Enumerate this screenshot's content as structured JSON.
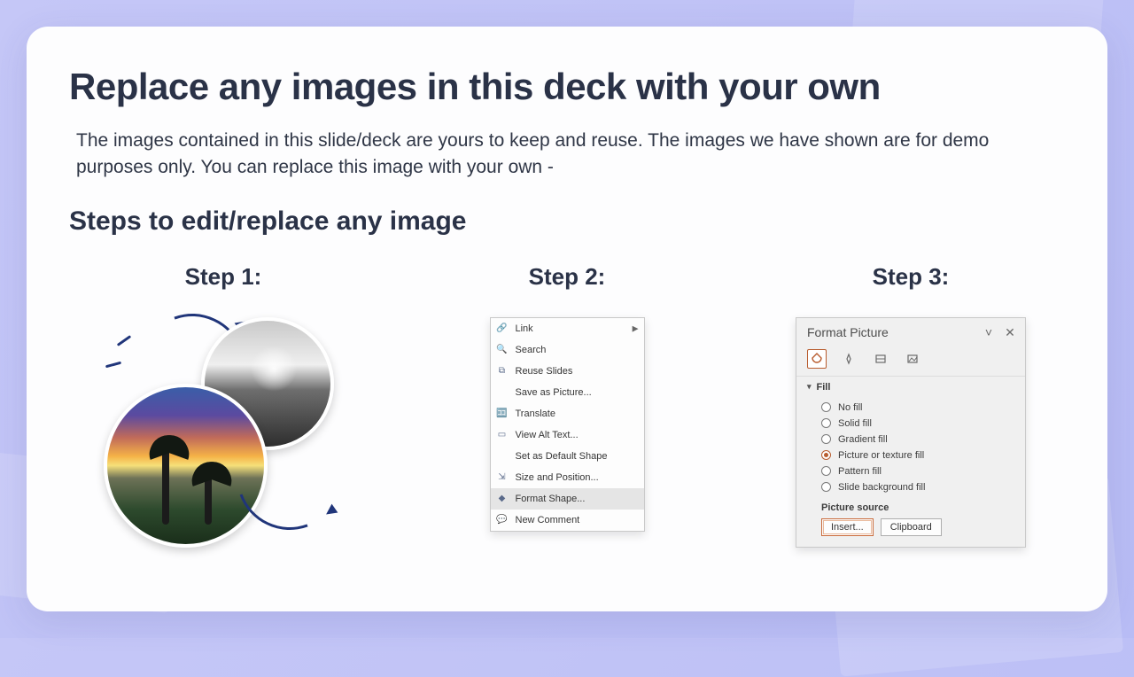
{
  "title": "Replace any images in this deck with your own",
  "description": "The images contained in this slide/deck are yours to keep and reuse. The images we have shown are for demo purposes only. You can replace this image with your own -",
  "subtitle": "Steps to edit/replace any image",
  "steps": {
    "s1": "Step 1:",
    "s2": "Step 2:",
    "s3": "Step 3:"
  },
  "context_menu": {
    "items": [
      {
        "label": "Link",
        "icon": "link",
        "submenu": true
      },
      {
        "label": "Search",
        "icon": "search"
      },
      {
        "label": "Reuse Slides",
        "icon": "reuse"
      },
      {
        "label": "Save as Picture...",
        "icon": ""
      },
      {
        "label": "Translate",
        "icon": "translate"
      },
      {
        "label": "View Alt Text...",
        "icon": "alt"
      },
      {
        "label": "Set as Default Shape",
        "icon": ""
      },
      {
        "label": "Size and Position...",
        "icon": "size"
      },
      {
        "label": "Format Shape...",
        "icon": "format",
        "selected": true
      },
      {
        "label": "New Comment",
        "icon": "comment"
      }
    ]
  },
  "format_panel": {
    "title": "Format Picture",
    "section": "Fill",
    "options": [
      {
        "label": "No fill",
        "checked": false
      },
      {
        "label": "Solid fill",
        "checked": false
      },
      {
        "label": "Gradient fill",
        "checked": false
      },
      {
        "label": "Picture or texture fill",
        "checked": true
      },
      {
        "label": "Pattern fill",
        "checked": false
      },
      {
        "label": "Slide background fill",
        "checked": false
      }
    ],
    "source_label": "Picture source",
    "buttons": {
      "insert": "Insert...",
      "clipboard": "Clipboard"
    }
  }
}
